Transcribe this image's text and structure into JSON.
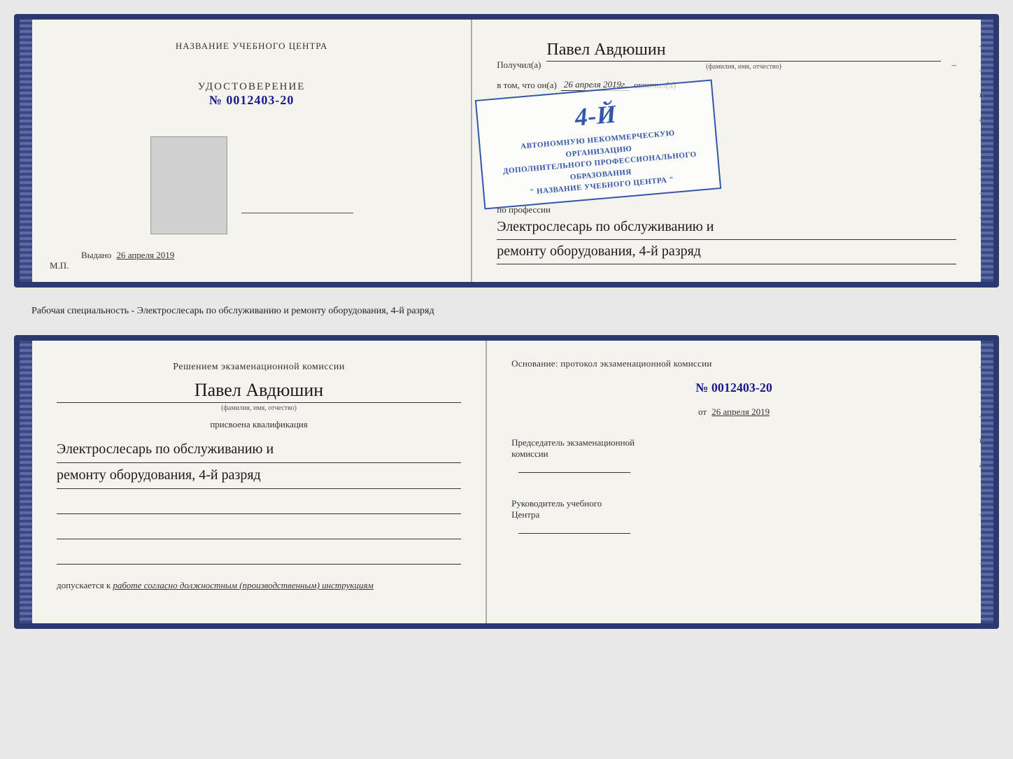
{
  "top_doc": {
    "left": {
      "org_name": "НАЗВАНИЕ УЧЕБНОГО ЦЕНТРА",
      "udostoverenie_label": "УДОСТОВЕРЕНИЕ",
      "number": "№ 0012403-20",
      "vydano_label": "Выдано",
      "vydano_date": "26 апреля 2019",
      "mp": "М.П."
    },
    "right": {
      "poluchil_label": "Получил(а)",
      "name": "Павел Авдюшин",
      "fio_hint": "(фамилия, имя, отчество)",
      "vtom_prefix": "в том, что он(а)",
      "date_italic": "26 апреля 2019г.",
      "okonchil": "окончил(а)",
      "stamp_line1": "АВТОНОМНУЮ НЕКОММЕРЧЕСКУЮ ОРГАНИЗАЦИЮ",
      "stamp_line2": "ДОПОЛНИТЕЛЬНОГО ПРОФЕССИОНАЛЬНОГО ОБРАЗОВАНИЯ",
      "stamp_grade": "4-й",
      "stamp_name": "\" НАЗВАНИЕ УЧЕБНОГО ЦЕНТРА \"",
      "po_professii": "по профессии",
      "profession_line1": "Электрослесарь по обслуживанию и",
      "profession_line2": "ремонту оборудования, 4-й разряд"
    }
  },
  "middle": {
    "text": "Рабочая специальность - Электрослесарь по обслуживанию и ремонту оборудования, 4-й разряд"
  },
  "bottom_doc": {
    "left": {
      "resheniem": "Решением экзаменационной комиссии",
      "name": "Павел Авдюшин",
      "fio_hint": "(фамилия, имя, отчество)",
      "prisvoena": "присвоена квалификация",
      "qual_line1": "Электрослесарь по обслуживанию и",
      "qual_line2": "ремонту оборудования, 4-й разряд",
      "dopuskaetsya": "допускается к",
      "dopusk_italic": "работе согласно должностным (производственным) инструкциям"
    },
    "right": {
      "osnovanie": "Основание: протокол экзаменационной комиссии",
      "number": "№ 0012403-20",
      "ot_prefix": "от",
      "ot_date": "26 апреля 2019",
      "predsedatel_line1": "Председатель экзаменационной",
      "predsedatel_line2": "комиссии",
      "rukovoditel_line1": "Руководитель учебного",
      "rukovoditel_line2": "Центра"
    }
  },
  "side_chars": {
    "chars": [
      "–",
      "–",
      "и",
      "а",
      "←",
      "–",
      "–",
      "–"
    ]
  }
}
